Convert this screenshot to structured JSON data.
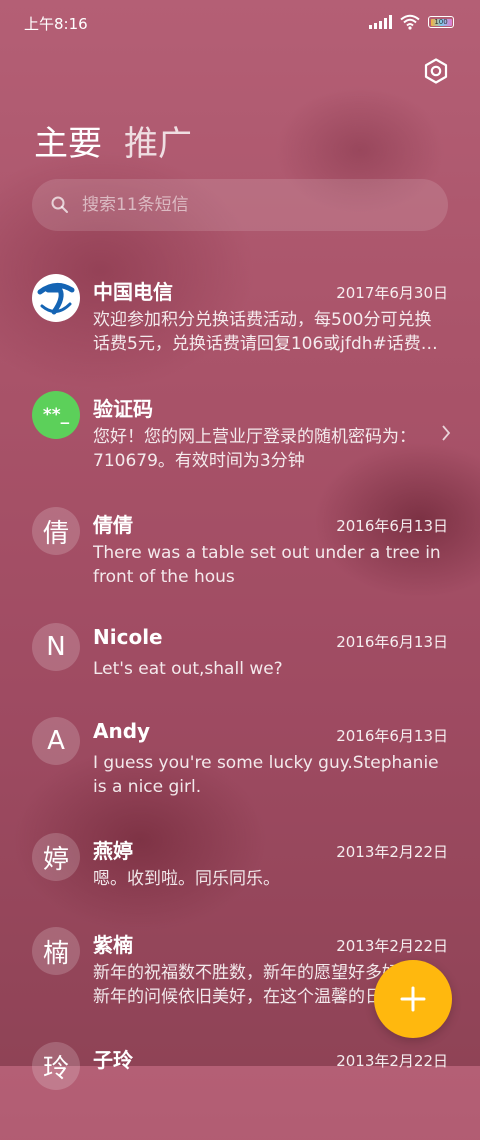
{
  "status": {
    "time": "上午8:16",
    "battery": "100"
  },
  "tabs": {
    "primary": "主要",
    "secondary": "推广"
  },
  "search": {
    "placeholder": "搜索11条短信"
  },
  "conversations": [
    {
      "avatar": "telecom-logo",
      "name": "中国电信",
      "date": "2017年6月30日",
      "preview": "欢迎参加积分兑换话费活动，每500分可兑换话费5元，兑换话费请回复106或jfdh#话费…"
    },
    {
      "avatar": "**_",
      "name": "验证码",
      "date": "",
      "preview": "您好！您的网上营业厅登录的随机密码为：710679。有效时间为3分钟"
    },
    {
      "avatar": "倩",
      "name": "倩倩",
      "date": "2016年6月13日",
      "preview": "There was a table set out under a tree in front of the hous"
    },
    {
      "avatar": "N",
      "name": "Nicole",
      "date": "2016年6月13日",
      "preview": "Let's eat out,shall we?"
    },
    {
      "avatar": "A",
      "name": "Andy",
      "date": "2016年6月13日",
      "preview": "I guess you're some lucky guy.Stephanie is a nice girl."
    },
    {
      "avatar": "婷",
      "name": "燕婷",
      "date": "2013年2月22日",
      "preview": "嗯。收到啦。同乐同乐。"
    },
    {
      "avatar": "楠",
      "name": "紫楠",
      "date": "2013年2月22日",
      "preview": "新年的祝福数不胜数，新年的愿望好多好多，新年的问候依旧美好，在这个温馨的日子里"
    },
    {
      "avatar": "玲",
      "name": "子玲",
      "date": "2013年2月22日",
      "preview": ""
    }
  ],
  "colors": {
    "fab": "#ffb80e",
    "code_avatar": "#5cd05a",
    "telecom_blue": "#1464b4"
  },
  "icons": {
    "settings": "settings-icon",
    "search": "search-icon",
    "fab": "plus-icon",
    "chevron": "chevron-right-icon"
  }
}
